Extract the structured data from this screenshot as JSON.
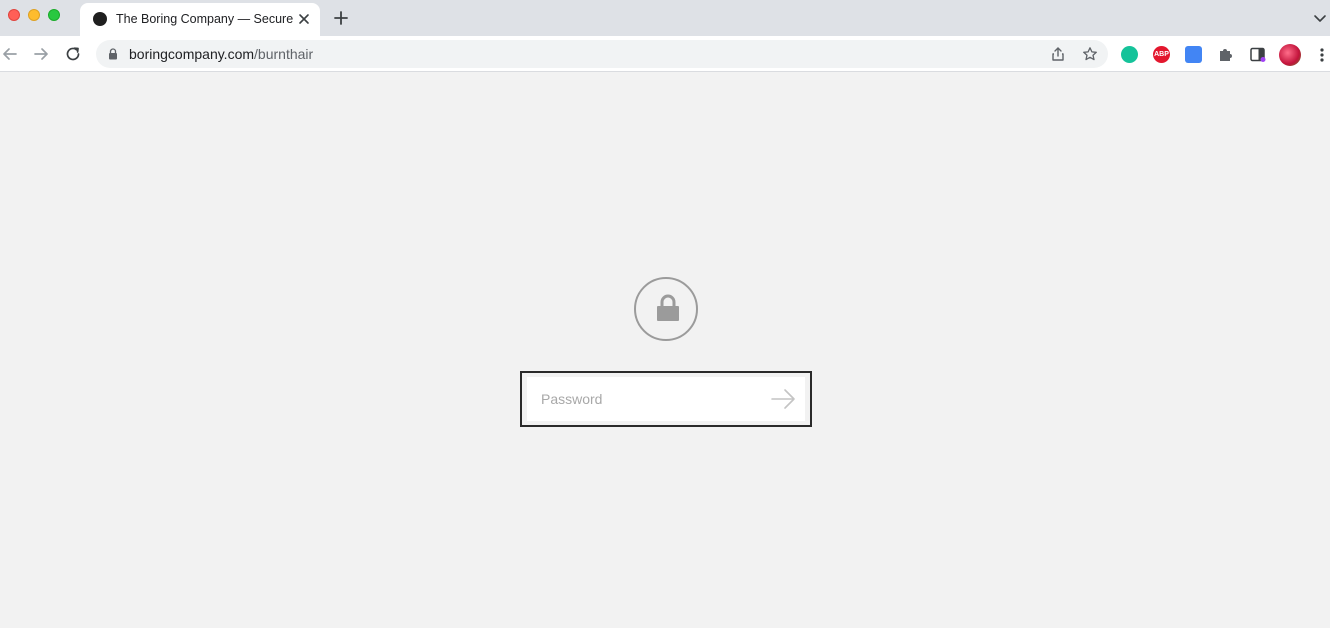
{
  "browser": {
    "tab": {
      "title": "The Boring Company — Secure"
    },
    "address_bar": {
      "domain": "boringcompany.com",
      "path": "/burnthair"
    },
    "extensions": {
      "abp_label": "ABP"
    }
  },
  "page": {
    "password_field": {
      "placeholder": "Password",
      "value": ""
    }
  },
  "icons": {
    "lock": "lock-icon",
    "submit": "arrow-right-icon"
  },
  "colors": {
    "page_background": "#f2f2f2",
    "frame_border": "#2a2a2a",
    "icon_gray": "#9b9b9b"
  }
}
